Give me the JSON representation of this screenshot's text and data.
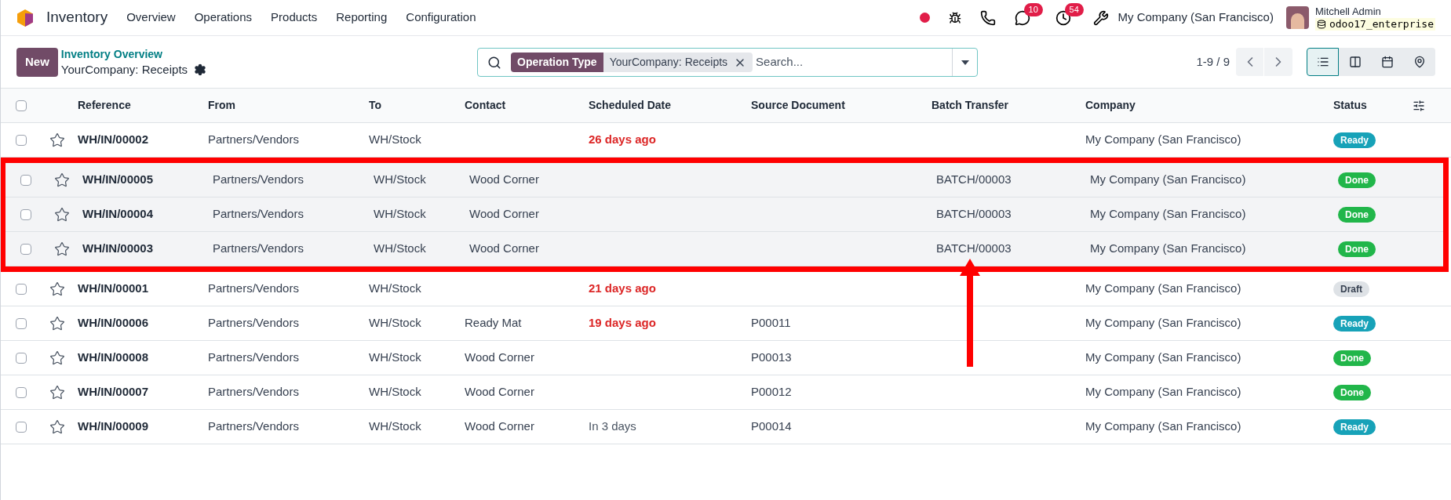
{
  "navbar": {
    "app_name": "Inventory",
    "menu": [
      "Overview",
      "Operations",
      "Products",
      "Reporting",
      "Configuration"
    ],
    "messages_count": "10",
    "activities_count": "54",
    "company": "My Company (San Francisco)",
    "user": {
      "name": "Mitchell Admin",
      "database": "odoo17_enterprise"
    }
  },
  "control_panel": {
    "new_button": "New",
    "breadcrumb": "Inventory Overview",
    "title": "YourCompany: Receipts",
    "search": {
      "facet_label": "Operation Type",
      "facet_value": "YourCompany: Receipts",
      "placeholder": "Search..."
    },
    "pager": "1-9 / 9",
    "views": [
      {
        "kind": "list",
        "selected": true
      },
      {
        "kind": "kanban",
        "selected": false
      },
      {
        "kind": "calendar",
        "selected": false
      },
      {
        "kind": "map",
        "selected": false
      }
    ]
  },
  "table": {
    "all_checked": false,
    "columns": [
      "Reference",
      "From",
      "To",
      "Contact",
      "Scheduled Date",
      "Source Document",
      "Batch Transfer",
      "Company",
      "Status"
    ],
    "rows": [
      {
        "reference": "WH/IN/00002",
        "from": "Partners/Vendors",
        "to": "WH/Stock",
        "scheduled": {
          "text": "26 days ago",
          "overdue": true
        },
        "company": "My Company (San Francisco)",
        "status": {
          "label": "Ready",
          "kind": "ready"
        },
        "checked": false,
        "starred": false,
        "highlighted": false
      },
      {
        "reference": "WH/IN/00005",
        "from": "Partners/Vendors",
        "to": "WH/Stock",
        "contact": "Wood Corner",
        "batch": "BATCH/00003",
        "company": "My Company (San Francisco)",
        "status": {
          "label": "Done",
          "kind": "done"
        },
        "checked": false,
        "starred": false,
        "highlighted": true
      },
      {
        "reference": "WH/IN/00004",
        "from": "Partners/Vendors",
        "to": "WH/Stock",
        "contact": "Wood Corner",
        "batch": "BATCH/00003",
        "company": "My Company (San Francisco)",
        "status": {
          "label": "Done",
          "kind": "done"
        },
        "checked": false,
        "starred": false,
        "highlighted": true
      },
      {
        "reference": "WH/IN/00003",
        "from": "Partners/Vendors",
        "to": "WH/Stock",
        "contact": "Wood Corner",
        "batch": "BATCH/00003",
        "company": "My Company (San Francisco)",
        "status": {
          "label": "Done",
          "kind": "done"
        },
        "checked": false,
        "starred": false,
        "highlighted": true
      },
      {
        "reference": "WH/IN/00001",
        "from": "Partners/Vendors",
        "to": "WH/Stock",
        "scheduled": {
          "text": "21 days ago",
          "overdue": true
        },
        "company": "My Company (San Francisco)",
        "status": {
          "label": "Draft",
          "kind": "draft"
        },
        "checked": false,
        "starred": false,
        "highlighted": false
      },
      {
        "reference": "WH/IN/00006",
        "from": "Partners/Vendors",
        "to": "WH/Stock",
        "contact": "Ready Mat",
        "scheduled": {
          "text": "19 days ago",
          "overdue": true
        },
        "source": "P00011",
        "company": "My Company (San Francisco)",
        "status": {
          "label": "Ready",
          "kind": "ready"
        },
        "checked": false,
        "starred": false,
        "highlighted": false
      },
      {
        "reference": "WH/IN/00008",
        "from": "Partners/Vendors",
        "to": "WH/Stock",
        "contact": "Wood Corner",
        "source": "P00013",
        "company": "My Company (San Francisco)",
        "status": {
          "label": "Done",
          "kind": "done"
        },
        "checked": false,
        "starred": false,
        "highlighted": false
      },
      {
        "reference": "WH/IN/00007",
        "from": "Partners/Vendors",
        "to": "WH/Stock",
        "contact": "Wood Corner",
        "source": "P00012",
        "company": "My Company (San Francisco)",
        "status": {
          "label": "Done",
          "kind": "done"
        },
        "checked": false,
        "starred": false,
        "highlighted": false
      },
      {
        "reference": "WH/IN/00009",
        "from": "Partners/Vendors",
        "to": "WH/Stock",
        "contact": "Wood Corner",
        "scheduled": {
          "text": "In 3 days",
          "overdue": false
        },
        "source": "P00014",
        "company": "My Company (San Francisco)",
        "status": {
          "label": "Ready",
          "kind": "ready"
        },
        "checked": false,
        "starred": false,
        "highlighted": false
      }
    ]
  }
}
